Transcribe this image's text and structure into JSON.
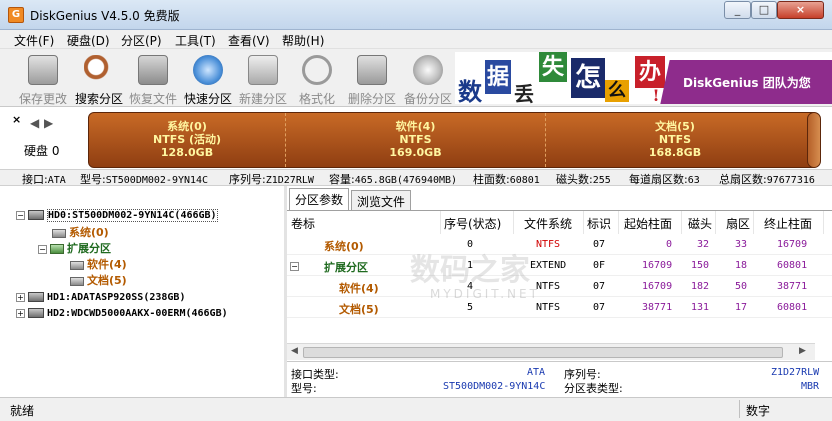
{
  "window": {
    "title": "DiskGenius V4.5.0 免费版",
    "app_icon_letter": "G"
  },
  "menu": [
    "文件(F)",
    "硬盘(D)",
    "分区(P)",
    "工具(T)",
    "查看(V)",
    "帮助(H)"
  ],
  "toolbar": {
    "buttons": [
      {
        "label": "保存更改",
        "icon": "floppy-icon",
        "state": "disabled"
      },
      {
        "label": "搜索分区",
        "icon": "magnifier-icon",
        "state": "normal"
      },
      {
        "label": "恢复文件",
        "icon": "restore-icon",
        "state": "disabled"
      },
      {
        "label": "快速分区",
        "icon": "quick-partition-icon",
        "state": "normal"
      },
      {
        "label": "新建分区",
        "icon": "new-partition-icon",
        "state": "disabled"
      },
      {
        "label": "格式化",
        "icon": "format-icon",
        "state": "disabled"
      },
      {
        "label": "删除分区",
        "icon": "delete-partition-icon",
        "state": "disabled"
      },
      {
        "label": "备份分区",
        "icon": "backup-icon",
        "state": "disabled"
      }
    ]
  },
  "banner": {
    "chars": [
      "数",
      "据",
      "丢",
      "失",
      "怎",
      "么",
      "办",
      "!"
    ],
    "text": "DiskGenius 团队为您"
  },
  "disk_bar": {
    "close": "×",
    "label": "硬盘 0",
    "partitions": [
      {
        "name": "系统(0)",
        "fs": "NTFS (活动)",
        "size": "128.0GB"
      },
      {
        "name": "软件(4)",
        "fs": "NTFS",
        "size": "169.0GB"
      },
      {
        "name": "文档(5)",
        "fs": "NTFS",
        "size": "168.8GB"
      }
    ]
  },
  "disk_info": {
    "interface_label": "接口:",
    "interface": "ATA",
    "model_label": "型号:",
    "model": "ST500DM002-9YN14C",
    "serial_label": "序列号:",
    "serial": "Z1D27RLW",
    "capacity_label": "容量:",
    "capacity": "465.8GB(476940MB)",
    "cylinders_label": "柱面数:",
    "cylinders": "60801",
    "heads_label": "磁头数:",
    "heads": "255",
    "sectors_per_track_label": "每道扇区数:",
    "sectors_per_track": "63",
    "total_sectors_label": "总扇区数:",
    "total_sectors": "97677316"
  },
  "tree": {
    "hd0": "HD0:ST500DM002-9YN14C(466GB)",
    "hd0_children": [
      {
        "label": "系统(0)"
      },
      {
        "label": "扩展分区"
      },
      {
        "label": "软件(4)"
      },
      {
        "label": "文档(5)"
      }
    ],
    "hd1": "HD1:ADATASP920SS(238GB)",
    "hd2": "HD2:WDCWD5000AAKX-00ERM(466GB)"
  },
  "tabs": [
    "分区参数",
    "浏览文件"
  ],
  "table": {
    "headers": [
      "卷标",
      "序号(状态)",
      "文件系统",
      "标识",
      "起始柱面",
      "磁头",
      "扇区",
      "终止柱面"
    ],
    "rows": [
      {
        "label": "系统(0)",
        "index": "0",
        "fs": "NTFS",
        "id": "07",
        "start_cyl": "0",
        "head": "32",
        "sector": "33",
        "end_cyl": "16709"
      },
      {
        "label": "扩展分区",
        "index": "1",
        "fs": "EXTEND",
        "id": "0F",
        "start_cyl": "16709",
        "head": "150",
        "sector": "18",
        "end_cyl": "60801"
      },
      {
        "label": "软件(4)",
        "index": "4",
        "fs": "NTFS",
        "id": "07",
        "start_cyl": "16709",
        "head": "182",
        "sector": "50",
        "end_cyl": "38771"
      },
      {
        "label": "文档(5)",
        "index": "5",
        "fs": "NTFS",
        "id": "07",
        "start_cyl": "38771",
        "head": "131",
        "sector": "17",
        "end_cyl": "60801"
      }
    ]
  },
  "details": {
    "interface_type_label": "接口类型:",
    "interface_type": "ATA",
    "model_label": "型号:",
    "model": "ST500DM002-9YN14C",
    "serial_label": "序列号:",
    "serial": "Z1D27RLW",
    "partition_table_label": "分区表类型:",
    "partition_table": "MBR"
  },
  "watermark": {
    "main": "数码之家",
    "sub": "MYDIGIT.NET"
  },
  "status": {
    "text": "就绪",
    "mode": "数字"
  },
  "colors": {
    "disk_bar": "#b5581d",
    "partition_text": "#fff6a0",
    "banner_purple": "#8e2c8c"
  }
}
